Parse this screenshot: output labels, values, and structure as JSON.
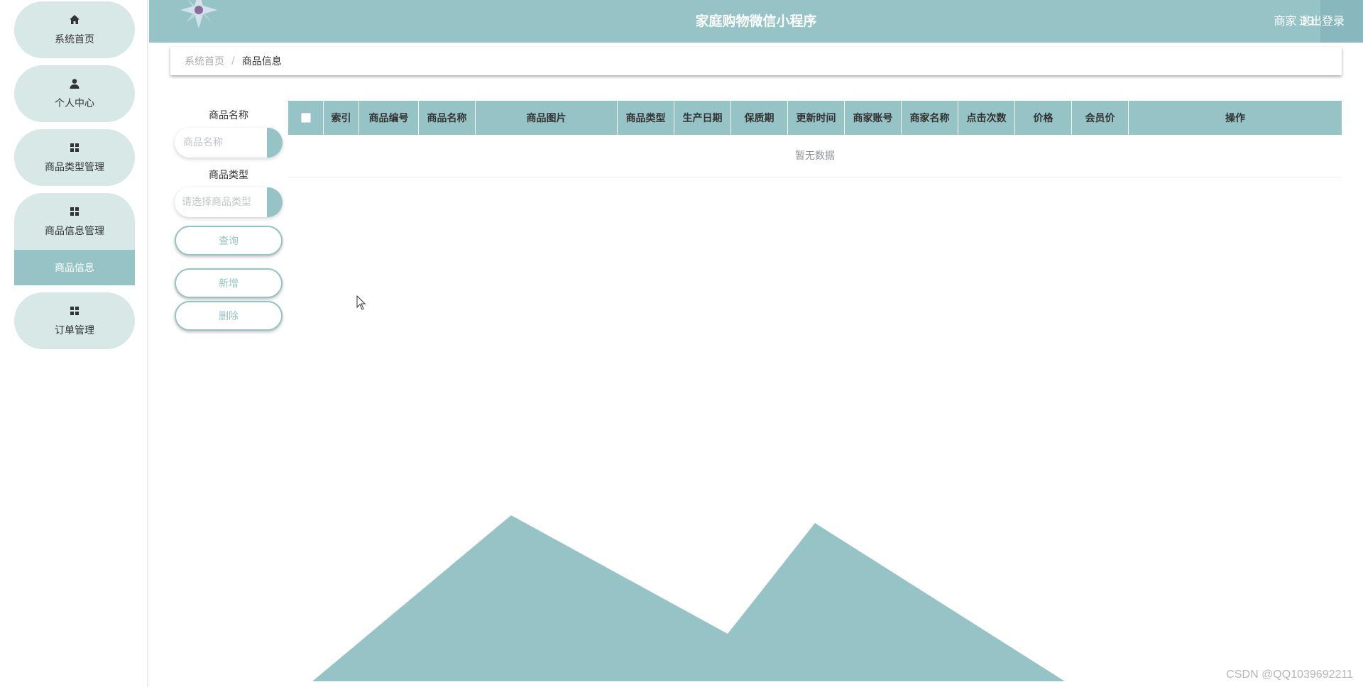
{
  "app": {
    "title": "家庭购物微信小程序",
    "user_label": "商家 33",
    "logout_label": "退出登录",
    "accent_color": "#96c3c5"
  },
  "sidebar": {
    "items": [
      {
        "label": "系统首页",
        "icon": "home-icon"
      },
      {
        "label": "个人中心",
        "icon": "user-icon"
      },
      {
        "label": "商品类型管理",
        "icon": "grid-icon"
      },
      {
        "label": "商品信息管理",
        "icon": "grid-icon"
      },
      {
        "label": "订单管理",
        "icon": "grid-icon"
      }
    ],
    "active_submenu": {
      "label": "商品信息"
    }
  },
  "breadcrumb": {
    "home": "系统首页",
    "separator": "/",
    "current": "商品信息"
  },
  "search": {
    "name_label": "商品名称",
    "name_placeholder": "商品名称",
    "name_value": "",
    "type_label": "商品类型",
    "type_placeholder": "请选择商品类型",
    "query_button": "查询",
    "add_button": "新增",
    "delete_button": "删除"
  },
  "table": {
    "columns": [
      "索引",
      "商品编号",
      "商品名称",
      "商品图片",
      "商品类型",
      "生产日期",
      "保质期",
      "更新时间",
      "商家账号",
      "商家名称",
      "点击次数",
      "价格",
      "会员价",
      "操作"
    ],
    "rows": [],
    "empty_text": "暂无数据"
  },
  "watermark": "CSDN @QQ1039692211"
}
